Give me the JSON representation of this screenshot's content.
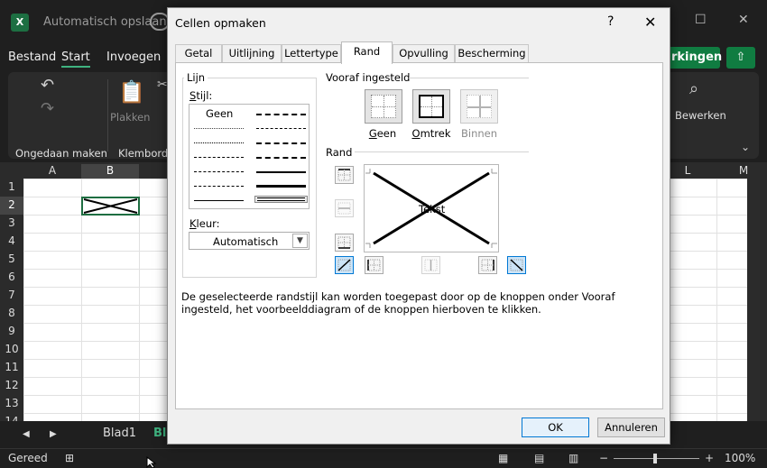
{
  "excel": {
    "app_icon": "excel-logo-icon",
    "app_letter": "X",
    "autosave_label": "Automatisch opslaan",
    "menu": [
      "Bestand",
      "Start",
      "Invoegen"
    ],
    "share_label": "rkingen",
    "ribbon": {
      "undo_group": "Ongedaan maken",
      "clipboard_group": "Klembord",
      "paste_label": "Plakken",
      "edit_label": "Bewerken"
    },
    "columns": [
      "A",
      "B",
      "L",
      "M"
    ],
    "rows": [
      "1",
      "2",
      "3",
      "4",
      "5",
      "6",
      "7",
      "8",
      "9",
      "10",
      "11",
      "12",
      "13",
      "14"
    ],
    "sheet_tabs": [
      "Blad1",
      "Bl"
    ],
    "status": {
      "ready": "Gereed",
      "zoom": "100%"
    }
  },
  "dialog": {
    "title": "Cellen opmaken",
    "help": "?",
    "close": "✕",
    "tabs": [
      "Getal",
      "Uitlijning",
      "Lettertype",
      "Rand",
      "Opvulling",
      "Bescherming"
    ],
    "active_tab": "Rand",
    "line_group": "Lijn",
    "style_label": "Stijl:",
    "style_none": "Geen",
    "color_label": "Kleur:",
    "color_value": "Automatisch",
    "presets_group": "Vooraf ingesteld",
    "presets": [
      {
        "label": "Geen",
        "state": "enabled"
      },
      {
        "label": "Omtrek",
        "state": "enabled"
      },
      {
        "label": "Binnen",
        "state": "disabled"
      }
    ],
    "border_group": "Rand",
    "preview_text": "Tekst",
    "description": "De geselecteerde randstijl kan worden toegepast door op de knoppen onder Vooraf ingesteld, het voorbeelddiagram of de knoppen hierboven te klikken.",
    "ok_label": "OK",
    "cancel_label": "Annuleren",
    "accent_color": "#0078d4"
  }
}
